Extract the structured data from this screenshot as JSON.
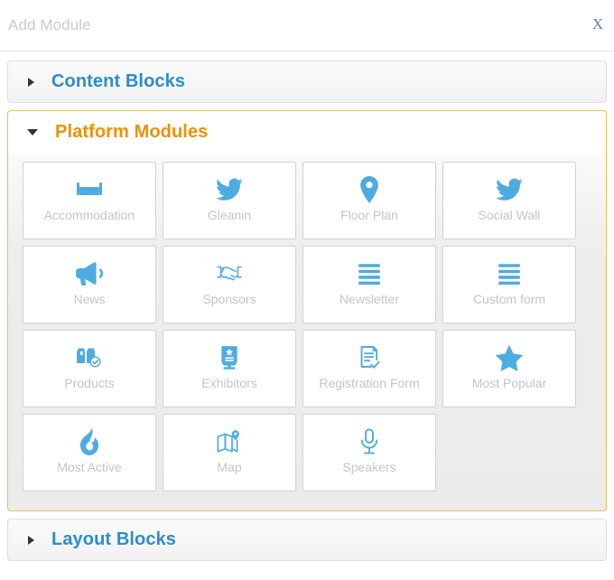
{
  "modal": {
    "title": "Add Module",
    "close_label": "X"
  },
  "accordion": {
    "sections": [
      {
        "title": "Content Blocks",
        "expanded": false,
        "color": "#2c8dcc"
      },
      {
        "title": "Platform Modules",
        "expanded": true,
        "color": "#f09000"
      },
      {
        "title": "Layout Blocks",
        "expanded": false,
        "color": "#2c8dcc"
      }
    ]
  },
  "platform_modules": {
    "tiles": [
      {
        "label": "Accommodation",
        "icon": "bed-icon"
      },
      {
        "label": "Gleanin",
        "icon": "twitter-bird-icon"
      },
      {
        "label": "Floor Plan",
        "icon": "map-pin-icon"
      },
      {
        "label": "Social Wall",
        "icon": "twitter-bird-icon"
      },
      {
        "label": "News",
        "icon": "megaphone-icon"
      },
      {
        "label": "Sponsors",
        "icon": "handshake-icon"
      },
      {
        "label": "Newsletter",
        "icon": "list-bars-icon"
      },
      {
        "label": "Custom form",
        "icon": "list-bars-icon"
      },
      {
        "label": "Products",
        "icon": "boxes-check-icon"
      },
      {
        "label": "Exhibitors",
        "icon": "exhibitor-booth-icon"
      },
      {
        "label": "Registration Form",
        "icon": "form-check-icon"
      },
      {
        "label": "Most Popular",
        "icon": "star-icon"
      },
      {
        "label": "Most Active",
        "icon": "flame-icon"
      },
      {
        "label": "Map",
        "icon": "folded-map-icon"
      },
      {
        "label": "Speakers",
        "icon": "microphone-icon"
      }
    ]
  },
  "colors": {
    "icon_blue": "#4eabe2",
    "accent_orange": "#f09000",
    "link_blue": "#2c8dcc",
    "label_gray": "#c3c5c8"
  }
}
